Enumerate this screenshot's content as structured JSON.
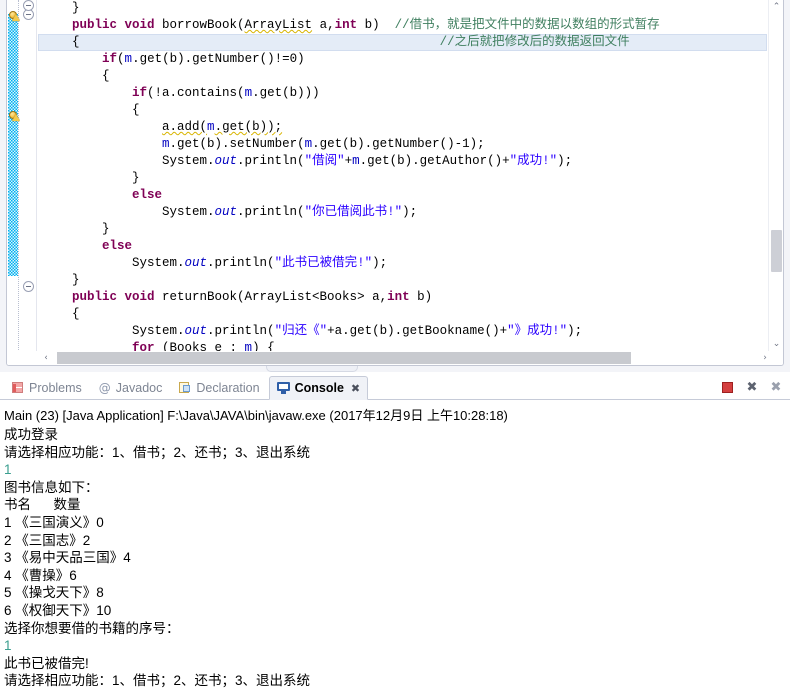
{
  "editor": {
    "lines": [
      {
        "indent": 0,
        "highlight": false,
        "segments": [
          {
            "t": "    }",
            "c": "plain"
          }
        ]
      },
      {
        "indent": 0,
        "highlight": false,
        "segments": [
          {
            "t": "    ",
            "c": "plain"
          },
          {
            "t": "public void ",
            "c": "kw"
          },
          {
            "t": "borrowBook(",
            "c": "plain"
          },
          {
            "t": "ArrayList",
            "c": "warn"
          },
          {
            "t": " a,",
            "c": "plain"
          },
          {
            "t": "int",
            "c": "kw"
          },
          {
            "t": " b)  ",
            "c": "plain"
          },
          {
            "t": "//借书，就是把文件中的数据以数组的形式暂存",
            "c": "cmt"
          }
        ]
      },
      {
        "indent": 0,
        "highlight": true,
        "segments": [
          {
            "t": "    {                                        ",
            "c": "plain"
          },
          {
            "t": "        //之后就把修改后的数据返回文件",
            "c": "cmt"
          }
        ]
      },
      {
        "indent": 0,
        "highlight": false,
        "segments": [
          {
            "t": "        ",
            "c": "plain"
          },
          {
            "t": "if",
            "c": "kw"
          },
          {
            "t": "(",
            "c": "plain"
          },
          {
            "t": "m",
            "c": "fld"
          },
          {
            "t": ".get(b).getNumber()!=0)",
            "c": "plain"
          }
        ]
      },
      {
        "indent": 0,
        "highlight": false,
        "segments": [
          {
            "t": "        {",
            "c": "plain"
          }
        ]
      },
      {
        "indent": 0,
        "highlight": false,
        "segments": [
          {
            "t": "            ",
            "c": "plain"
          },
          {
            "t": "if",
            "c": "kw"
          },
          {
            "t": "(!a.contains(",
            "c": "plain"
          },
          {
            "t": "m",
            "c": "fld"
          },
          {
            "t": ".get(b)))",
            "c": "plain"
          }
        ]
      },
      {
        "indent": 0,
        "highlight": false,
        "segments": [
          {
            "t": "            {",
            "c": "plain"
          }
        ]
      },
      {
        "indent": 0,
        "highlight": false,
        "segments": [
          {
            "t": "                ",
            "c": "plain"
          },
          {
            "t": "a.add(",
            "c": "warn"
          },
          {
            "t": "m",
            "c": "fld"
          },
          {
            "t": ".get(b));",
            "c": "warn"
          }
        ]
      },
      {
        "indent": 0,
        "highlight": false,
        "segments": [
          {
            "t": "                ",
            "c": "plain"
          },
          {
            "t": "m",
            "c": "fld"
          },
          {
            "t": ".get(b).setNumber(",
            "c": "plain"
          },
          {
            "t": "m",
            "c": "fld"
          },
          {
            "t": ".get(b).getNumber()-1);",
            "c": "plain"
          }
        ]
      },
      {
        "indent": 0,
        "highlight": false,
        "segments": [
          {
            "t": "                System.",
            "c": "plain"
          },
          {
            "t": "out",
            "c": "stfld"
          },
          {
            "t": ".println(",
            "c": "plain"
          },
          {
            "t": "\"借阅\"",
            "c": "str"
          },
          {
            "t": "+",
            "c": "plain"
          },
          {
            "t": "m",
            "c": "fld"
          },
          {
            "t": ".get(b).getAuthor()+",
            "c": "plain"
          },
          {
            "t": "\"成功!\"",
            "c": "str"
          },
          {
            "t": ");",
            "c": "plain"
          }
        ]
      },
      {
        "indent": 0,
        "highlight": false,
        "segments": [
          {
            "t": "            }",
            "c": "plain"
          }
        ]
      },
      {
        "indent": 0,
        "highlight": false,
        "segments": [
          {
            "t": "            ",
            "c": "plain"
          },
          {
            "t": "else",
            "c": "kw"
          }
        ]
      },
      {
        "indent": 0,
        "highlight": false,
        "segments": [
          {
            "t": "                System.",
            "c": "plain"
          },
          {
            "t": "out",
            "c": "stfld"
          },
          {
            "t": ".println(",
            "c": "plain"
          },
          {
            "t": "\"你已借阅此书!\"",
            "c": "str"
          },
          {
            "t": ");",
            "c": "plain"
          }
        ]
      },
      {
        "indent": 0,
        "highlight": false,
        "segments": [
          {
            "t": "        }",
            "c": "plain"
          }
        ]
      },
      {
        "indent": 0,
        "highlight": false,
        "segments": [
          {
            "t": "        ",
            "c": "plain"
          },
          {
            "t": "else",
            "c": "kw"
          }
        ]
      },
      {
        "indent": 0,
        "highlight": false,
        "segments": [
          {
            "t": "            System.",
            "c": "plain"
          },
          {
            "t": "out",
            "c": "stfld"
          },
          {
            "t": ".println(",
            "c": "plain"
          },
          {
            "t": "\"此书已被借完!\"",
            "c": "str"
          },
          {
            "t": ");",
            "c": "plain"
          }
        ]
      },
      {
        "indent": 0,
        "highlight": false,
        "segments": [
          {
            "t": "    }",
            "c": "plain"
          }
        ]
      },
      {
        "indent": 0,
        "highlight": false,
        "segments": [
          {
            "t": "    ",
            "c": "plain"
          },
          {
            "t": "public void ",
            "c": "kw"
          },
          {
            "t": "returnBook(ArrayList<Books> a,",
            "c": "plain"
          },
          {
            "t": "int",
            "c": "kw"
          },
          {
            "t": " b)",
            "c": "plain"
          }
        ]
      },
      {
        "indent": 0,
        "highlight": false,
        "segments": [
          {
            "t": "    {",
            "c": "plain"
          }
        ]
      },
      {
        "indent": 0,
        "highlight": false,
        "segments": [
          {
            "t": "            System.",
            "c": "plain"
          },
          {
            "t": "out",
            "c": "stfld"
          },
          {
            "t": ".println(",
            "c": "plain"
          },
          {
            "t": "\"归还《\"",
            "c": "str"
          },
          {
            "t": "+a.get(b).getBookname()+",
            "c": "plain"
          },
          {
            "t": "\"》成功!\"",
            "c": "str"
          },
          {
            "t": ");",
            "c": "plain"
          }
        ]
      },
      {
        "indent": 0,
        "highlight": false,
        "segments": [
          {
            "t": "            ",
            "c": "plain"
          },
          {
            "t": "for",
            "c": "kw"
          },
          {
            "t": " (Books e : ",
            "c": "plain"
          },
          {
            "t": "m",
            "c": "fld"
          },
          {
            "t": ") {",
            "c": "plain"
          }
        ]
      }
    ],
    "scroll": {
      "up_arrow": "⌃",
      "down_arrow": "⌄",
      "left_arrow": "‹",
      "right_arrow": "›"
    }
  },
  "console_panel": {
    "tabs": [
      {
        "label": "Problems",
        "icon": "problems-icon",
        "active": false
      },
      {
        "label": "Javadoc",
        "icon": "javadoc-icon",
        "active": false
      },
      {
        "label": "Declaration",
        "icon": "declaration-icon",
        "active": false
      },
      {
        "label": "Console",
        "icon": "console-icon",
        "active": true
      }
    ],
    "close_glyph": "✖",
    "tools": [
      {
        "name": "terminate-button",
        "glyph": ""
      },
      {
        "name": "remove-launch-button",
        "glyph": "✖"
      },
      {
        "name": "remove-all-terminated-button",
        "glyph": "✖"
      }
    ],
    "header": "Main (23) [Java Application] F:\\Java\\JAVA\\bin\\javaw.exe (2017年12月9日 上午10:28:18)",
    "output": [
      {
        "text": "成功登录",
        "kind": "out"
      },
      {
        "text": "请选择相应功能：1、借书；2、还书；3、退出系统",
        "kind": "out"
      },
      {
        "text": "1",
        "kind": "in"
      },
      {
        "text": "图书信息如下：",
        "kind": "out"
      },
      {
        "text": "书名      数量",
        "kind": "out"
      },
      {
        "text": "1 《三国演义》0",
        "kind": "out"
      },
      {
        "text": "2 《三国志》2",
        "kind": "out"
      },
      {
        "text": "3 《易中天品三国》4",
        "kind": "out"
      },
      {
        "text": "4 《曹操》6",
        "kind": "out"
      },
      {
        "text": "5 《操戈天下》8",
        "kind": "out"
      },
      {
        "text": "6 《权御天下》10",
        "kind": "out"
      },
      {
        "text": "选择你想要借的书籍的序号：",
        "kind": "out"
      },
      {
        "text": "1",
        "kind": "in"
      },
      {
        "text": "此书已被借完!",
        "kind": "out"
      },
      {
        "text": "请选择相应功能：1、借书；2、还书；3、退出系统",
        "kind": "out"
      }
    ]
  },
  "colors": {
    "keyword": "#7f0055",
    "string": "#2a00ff",
    "comment": "#3f7f5f",
    "field": "#0000c0",
    "input_echo": "#3a9e8f",
    "change_bar": "#00b0f0",
    "current_line": "#e4ecf7",
    "terminate": "#d43f3f"
  }
}
